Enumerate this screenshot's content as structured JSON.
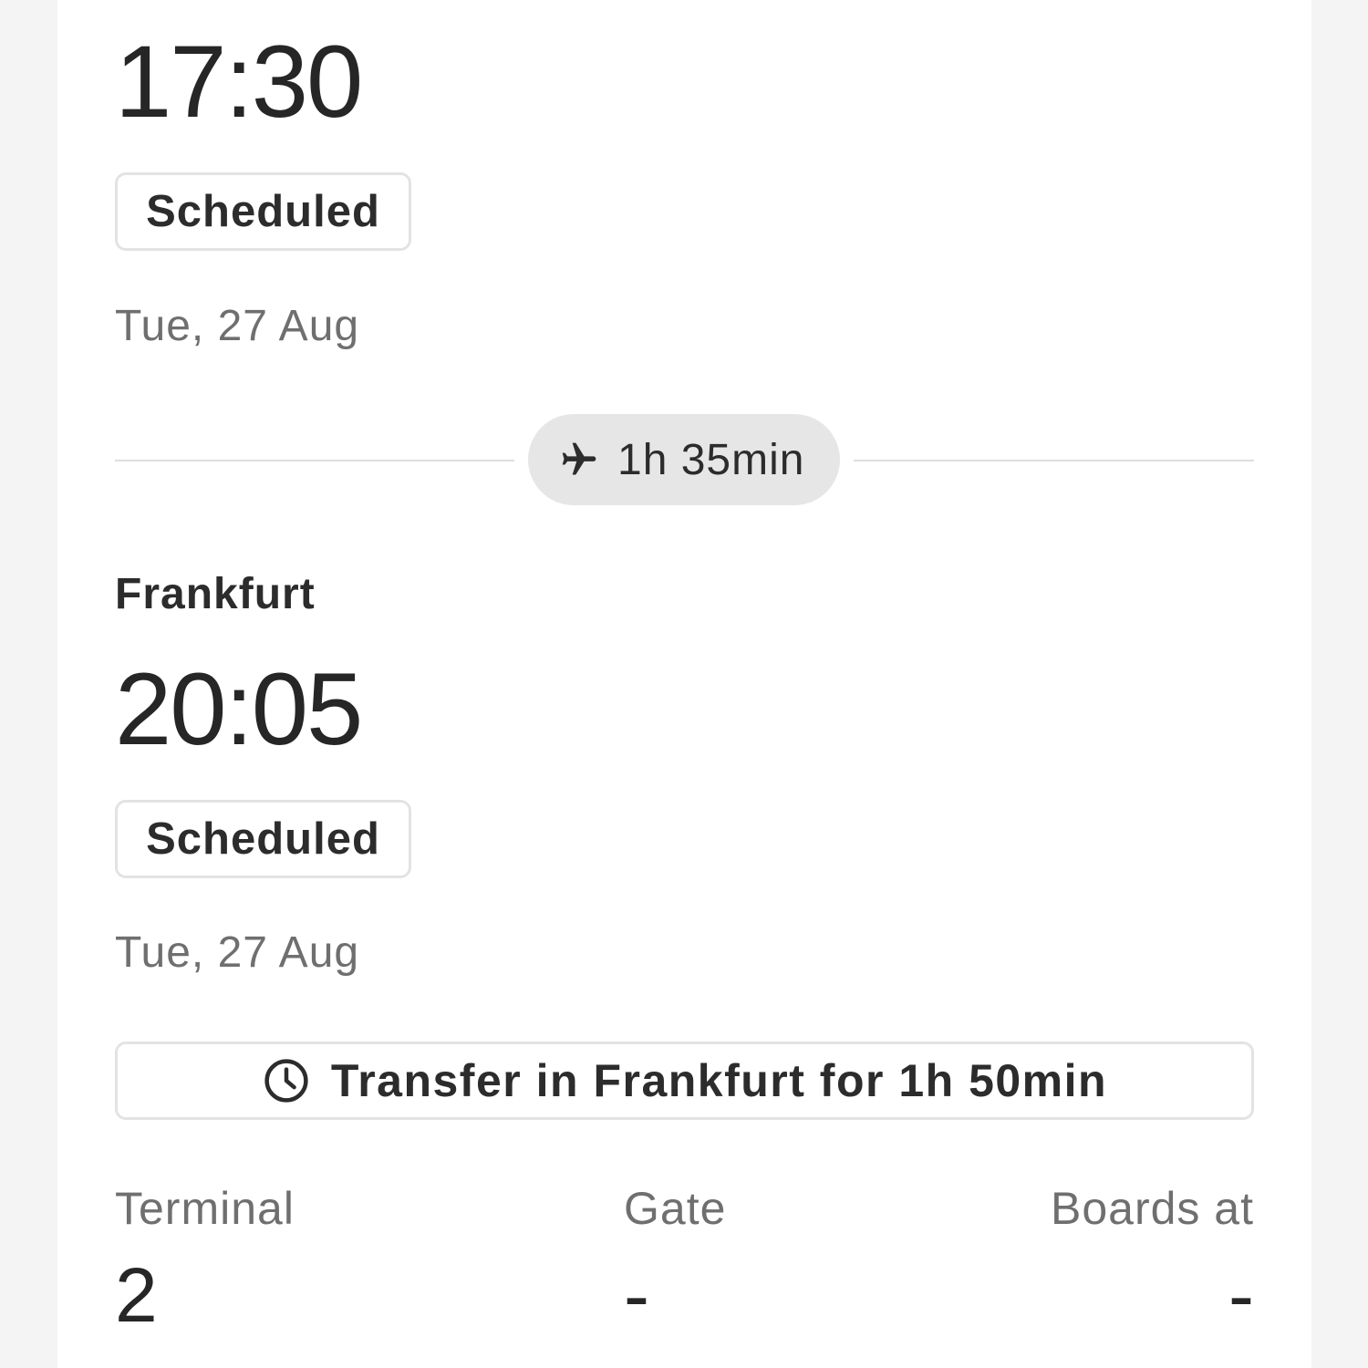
{
  "departure": {
    "time": "17:30",
    "status": "Scheduled",
    "date": "Tue, 27 Aug"
  },
  "flight": {
    "duration": "1h 35min",
    "icon": "airplane-icon"
  },
  "arrival": {
    "city": "Frankfurt",
    "time": "20:05",
    "status": "Scheduled",
    "date": "Tue, 27 Aug"
  },
  "transfer": {
    "icon": "clock-icon",
    "text": "Transfer in Frankfurt for 1h 50min"
  },
  "info": {
    "terminal": {
      "label": "Terminal",
      "value": "2"
    },
    "gate": {
      "label": "Gate",
      "value": "-"
    },
    "boards_at": {
      "label": "Boards at",
      "value": "-"
    }
  }
}
